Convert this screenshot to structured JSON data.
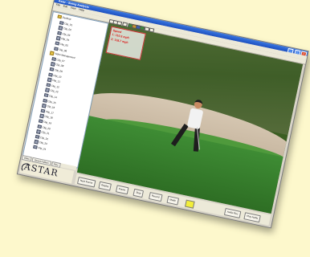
{
  "app": {
    "title": "Astar - Swing Analysis",
    "window_buttons": [
      "_",
      "□",
      "×"
    ]
  },
  "menu": {
    "items": [
      "File",
      "Edit",
      "View",
      "Help"
    ]
  },
  "toolbar": {
    "icons": [
      "new-icon",
      "open-icon",
      "save-icon",
      "print-icon",
      "camera-icon",
      "record-icon",
      "draw-icon",
      "color-icon",
      "undo-icon",
      "settings-icon"
    ]
  },
  "sidebar": {
    "tree": [
      {
        "label": "Desktop",
        "kind": "folder",
        "indent": 1
      },
      {
        "label": "Clip_01",
        "kind": "video",
        "indent": 2
      },
      {
        "label": "Clip_02",
        "kind": "video",
        "indent": 2
      },
      {
        "label": "Clip_03",
        "kind": "video",
        "indent": 2
      },
      {
        "label": "Clip_04",
        "kind": "video",
        "indent": 2
      },
      {
        "label": "Clip_05",
        "kind": "video",
        "indent": 2
      },
      {
        "label": "Clip_06",
        "kind": "video",
        "indent": 2
      },
      {
        "label": "Video Management",
        "kind": "folder",
        "indent": 1
      },
      {
        "label": "Clip_07",
        "kind": "video",
        "indent": 2
      },
      {
        "label": "Clip_08",
        "kind": "video",
        "indent": 2
      },
      {
        "label": "Clip_09",
        "kind": "video",
        "indent": 2
      },
      {
        "label": "Clip_10",
        "kind": "video",
        "indent": 2
      },
      {
        "label": "Clip_11",
        "kind": "video",
        "indent": 2
      },
      {
        "label": "Clip_12",
        "kind": "video",
        "indent": 2
      },
      {
        "label": "Clip_13",
        "kind": "video",
        "indent": 2
      },
      {
        "label": "Clip_14",
        "kind": "video",
        "indent": 2
      },
      {
        "label": "Clip_15",
        "kind": "video",
        "indent": 2
      },
      {
        "label": "Clip_16",
        "kind": "video",
        "indent": 2
      },
      {
        "label": "Clip_17",
        "kind": "video",
        "indent": 2
      },
      {
        "label": "Clip_18",
        "kind": "video",
        "indent": 2
      },
      {
        "label": "Clip_19",
        "kind": "video",
        "indent": 2
      },
      {
        "label": "Clip_20",
        "kind": "video",
        "indent": 2
      },
      {
        "label": "Clip_21",
        "kind": "video",
        "indent": 2
      },
      {
        "label": "Clip_22",
        "kind": "video",
        "indent": 2
      },
      {
        "label": "Clip_23",
        "kind": "video",
        "indent": 2
      },
      {
        "label": "Clip_24",
        "kind": "video",
        "indent": 2
      }
    ],
    "tabs": [
      "Video",
      "Sound Folders",
      "Files"
    ]
  },
  "logo": {
    "text": "ASTAR"
  },
  "overlay": {
    "heading": "Speed",
    "lines": [
      "1: 110.3 mph",
      "2: 118.7 mph"
    ]
  },
  "controls": {
    "buttons": [
      "Next Frame",
      "Replay",
      "Pause",
      "Stop",
      "Record",
      "Mode",
      "Audio Rec",
      "Play Audio"
    ]
  },
  "colors": {
    "background": "#fdf8cc",
    "titlebar": "#2a62d4",
    "overlay_text": "#dd1111",
    "indicator": "#f2ee39"
  }
}
